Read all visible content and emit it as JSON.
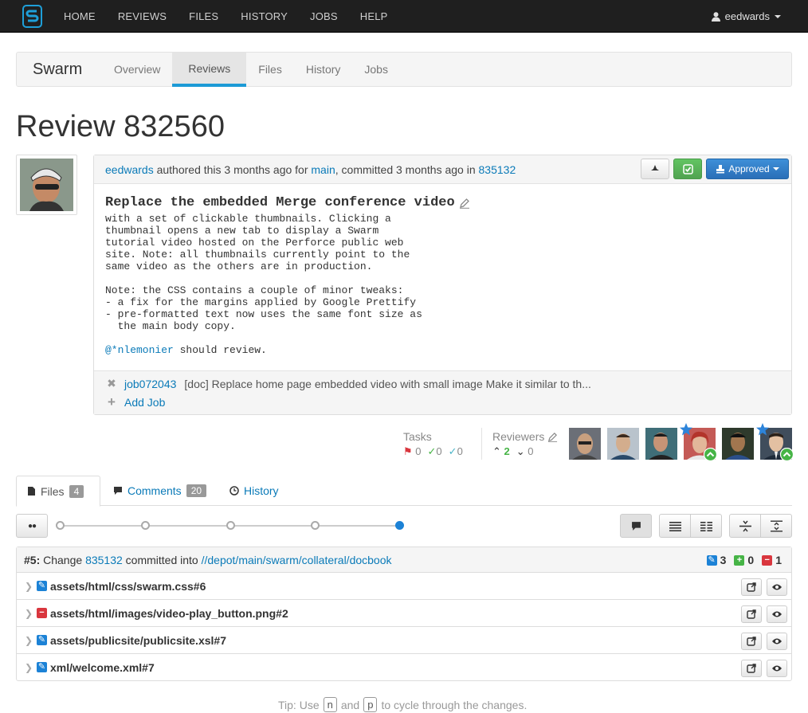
{
  "topnav": {
    "items": [
      "HOME",
      "REVIEWS",
      "FILES",
      "HISTORY",
      "JOBS",
      "HELP"
    ],
    "user": "eedwards"
  },
  "project": {
    "name": "Swarm",
    "tabs": [
      "Overview",
      "Reviews",
      "Files",
      "History",
      "Jobs"
    ],
    "active_tab": "Reviews"
  },
  "review": {
    "title": "Review 832560",
    "author": "eedwards",
    "authored_text": "authored this 3 months ago for",
    "branch": "main",
    "committed_text": ", committed 3 months ago in",
    "change": "835132",
    "state_label": "Approved",
    "subject": "Replace the embedded Merge conference video",
    "body": "with a set of clickable thumbnails. Clicking a\nthumbnail opens a new tab to display a Swarm\ntutorial video hosted on the Perforce public web\nsite. Note: all thumbnails currently point to the\nsame video as the others are in production.\n\nNote: the CSS contains a couple of minor tweaks:\n- a fix for the margins applied by Google Prettify\n- pre-formatted text now uses the same font size as\n  the main body copy.",
    "mention": "@*nlemonier",
    "mention_suffix": " should review."
  },
  "jobs": {
    "job_id": "job072043",
    "job_desc": "[doc] Replace home page embedded video with small image Make it similar to th...",
    "add_label": "Add Job"
  },
  "tasks": {
    "label": "Tasks",
    "open": "0",
    "addressed": "0",
    "verified": "0"
  },
  "reviewers": {
    "label": "Reviewers",
    "up": "2",
    "down": "0"
  },
  "file_tabs": {
    "files_label": "Files",
    "files_count": "4",
    "comments_label": "Comments",
    "comments_count": "20",
    "history_label": "History"
  },
  "change": {
    "prefix": "#5:",
    "change_word": "Change",
    "change_id": "835132",
    "committed_into": "committed into",
    "path": "//depot/main/swarm/collateral/docbook",
    "edited": "3",
    "added": "0",
    "deleted": "1"
  },
  "files": [
    {
      "name": "assets/html/css/swarm.css#6",
      "action": "edit"
    },
    {
      "name": "assets/html/images/video-play_button.png#2",
      "action": "delete"
    },
    {
      "name": "assets/publicsite/publicsite.xsl#7",
      "action": "edit"
    },
    {
      "name": "xml/welcome.xml#7",
      "action": "edit"
    }
  ],
  "tip": {
    "prefix": "Tip: Use",
    "key_n": "n",
    "and": "and",
    "key_p": "p",
    "suffix": "to cycle through the changes."
  },
  "colors": {
    "accent": "#1c82d6",
    "approve_green": "#51a351",
    "approved_blue": "#2a6fb8",
    "delete_red": "#d9363e",
    "link": "#0a7ab8"
  }
}
